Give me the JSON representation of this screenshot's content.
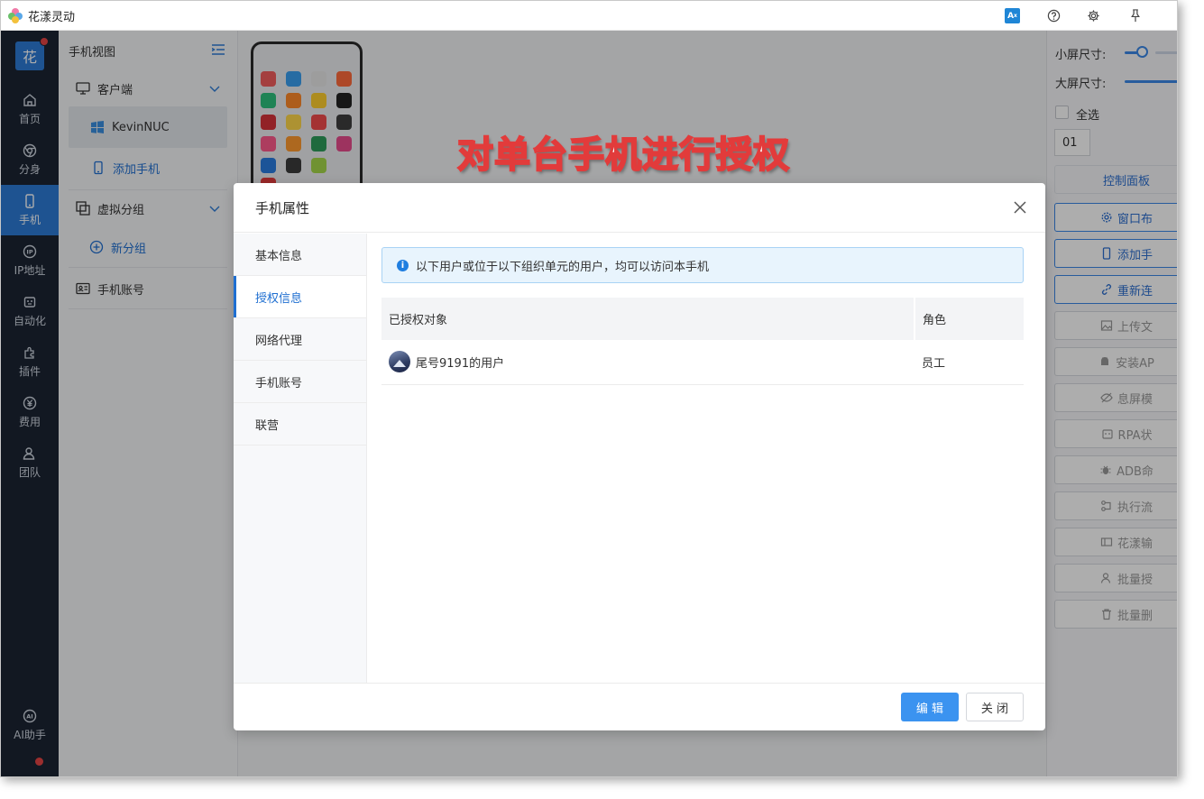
{
  "window": {
    "title": "花漾灵动"
  },
  "titlebar": {
    "icons": [
      "translate-icon",
      "help-icon",
      "settings-icon",
      "pin-icon"
    ]
  },
  "rail": {
    "logo_text": "花",
    "items": [
      {
        "label": "首页",
        "icon": "home-icon"
      },
      {
        "label": "分身",
        "icon": "chrome-icon"
      },
      {
        "label": "手机",
        "icon": "phone-icon"
      },
      {
        "label": "IP地址",
        "icon": "ip-icon"
      },
      {
        "label": "自动化",
        "icon": "robot-icon"
      },
      {
        "label": "插件",
        "icon": "puzzle-icon"
      },
      {
        "label": "费用",
        "icon": "yen-icon"
      },
      {
        "label": "团队",
        "icon": "team-icon"
      }
    ],
    "ai_label": "AI助手"
  },
  "tree": {
    "title": "手机视图",
    "client_label": "客户端",
    "client_item": "KevinNUC",
    "add_phone": "添加手机",
    "virtual_group": "虚拟分组",
    "new_group": "新分组",
    "phone_account": "手机账号"
  },
  "overlay": {
    "caption": "对单台手机进行授权"
  },
  "right_panel": {
    "small_screen_label": "小屏尺寸:",
    "large_screen_label": "大屏尺寸:",
    "select_all": "全选",
    "index_value": "01",
    "control_panel": "控制面板",
    "buttons": [
      "窗口布",
      "添加手",
      "重新连",
      "上传文",
      "安装AP",
      "息屏模",
      "RPA状",
      "ADB命",
      "执行流",
      "花漾输",
      "批量授",
      "批量删"
    ]
  },
  "modal": {
    "title": "手机属性",
    "nav": [
      "基本信息",
      "授权信息",
      "网络代理",
      "手机账号",
      "联营"
    ],
    "alert": "以下用户或位于以下组织单元的用户，均可以访问本手机",
    "table": {
      "headers": [
        "已授权对象",
        "角色"
      ],
      "rows": [
        {
          "name": "尾号9191的用户",
          "role": "员工"
        }
      ]
    },
    "edit_button": "编 辑",
    "close_button": "关 闭"
  },
  "colors": {
    "accent": "#1f6fd1",
    "rail_bg": "#1b2433",
    "primary_button": "#3b93f0",
    "overlay_stroke": "#e23b3b"
  }
}
